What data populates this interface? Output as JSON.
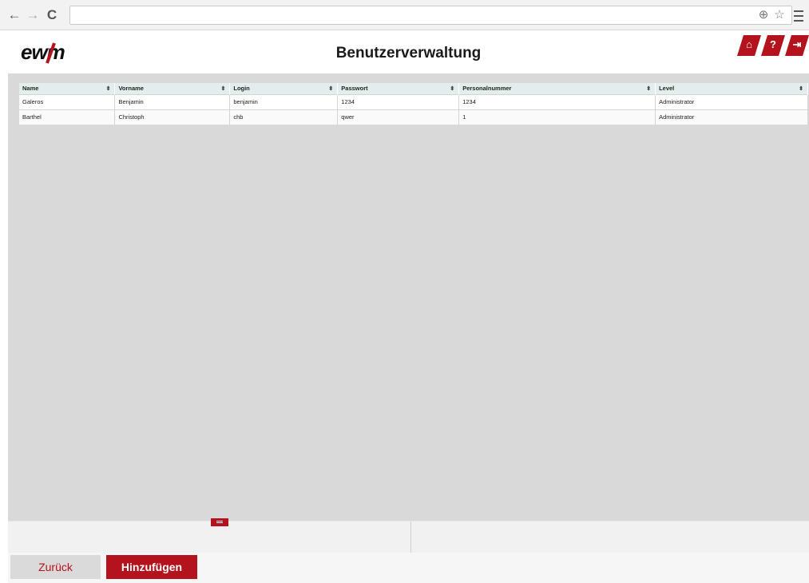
{
  "browser": {
    "url_value": "",
    "back_glyph": "←",
    "forward_glyph": "→",
    "reload_glyph": "C",
    "zoom_glyph": "⊕",
    "star_glyph": "☆"
  },
  "header": {
    "logo_text": "ewm",
    "title": "Benutzerverwaltung",
    "buttons": [
      {
        "name": "home",
        "glyph": "⌂"
      },
      {
        "name": "help",
        "glyph": "?"
      },
      {
        "name": "logout",
        "glyph": "⇥"
      }
    ]
  },
  "table": {
    "columns": [
      "Name",
      "Vorname",
      "Login",
      "Passwort",
      "Personalnummer",
      "Level"
    ],
    "sort_glyph": "⬍",
    "rows": [
      [
        "Galeros",
        "Benjamin",
        "benjamin",
        "1234",
        "1234",
        "Administrator"
      ],
      [
        "Barthel",
        "Christoph",
        "chb",
        "qwer",
        "1",
        "Administrator"
      ]
    ]
  },
  "footer": {
    "back_label": "Zurück",
    "add_label": "Hinzufügen"
  },
  "colors": {
    "accent": "#b4121c",
    "content_bg": "#d9d9d9",
    "header_row": "#e4eded"
  }
}
